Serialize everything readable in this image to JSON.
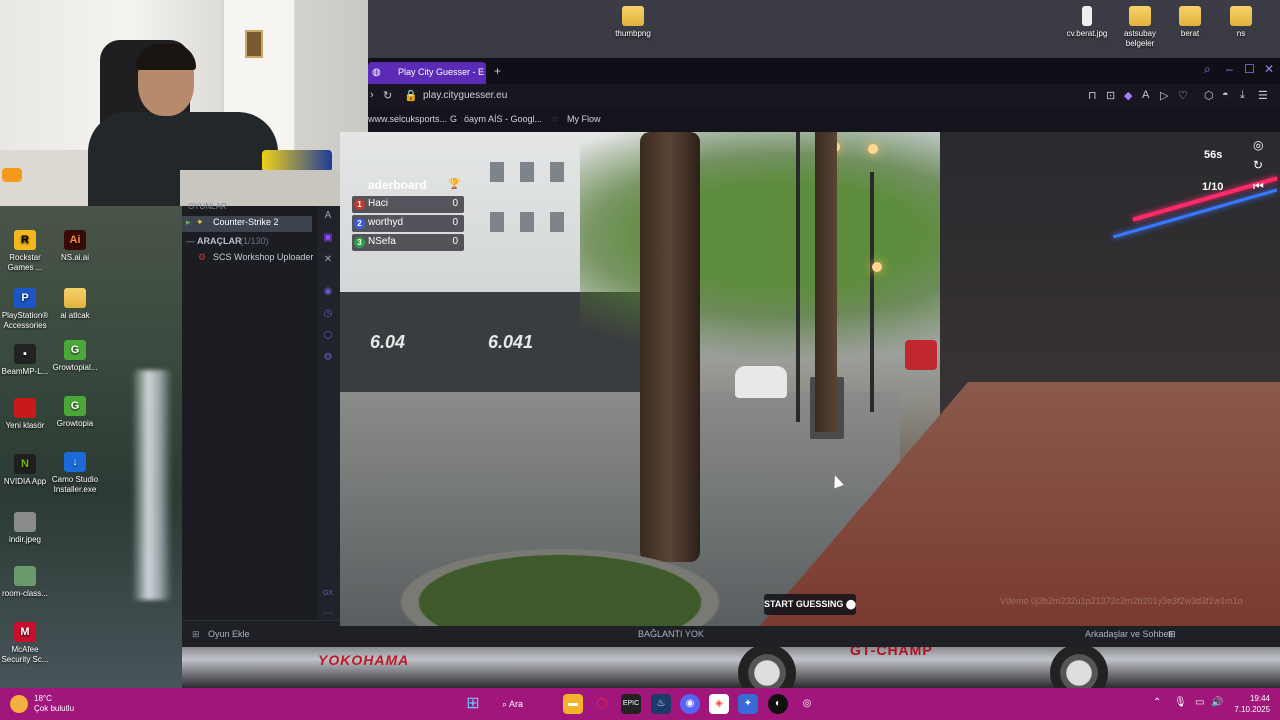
{
  "desktop": {
    "top_icons": [
      {
        "label": "thumbpng"
      },
      {
        "label": "cv.berat.jpg"
      },
      {
        "label": "astsubay belgeler"
      },
      {
        "label": "berat"
      },
      {
        "label": "ns"
      }
    ],
    "left_icons": [
      {
        "label": "Rockstar Games ..."
      },
      {
        "label": "NS.ai.ai"
      },
      {
        "label": "PlayStation® Accessories"
      },
      {
        "label": "ai atlcak"
      },
      {
        "label": "BeamMP-L..."
      },
      {
        "label": "Growtopial..."
      },
      {
        "label": "Yeni klasör"
      },
      {
        "label": "Growtopia"
      },
      {
        "label": "NVIDIA App"
      },
      {
        "label": "Camo Studio Installer.exe"
      },
      {
        "label": "indir.jpeg"
      },
      {
        "label": "room-class..."
      },
      {
        "label": "McAfee Security Sc..."
      }
    ],
    "wallpaper_brand": "YOKOHAMA",
    "wallpaper_brand2": "GT-CHAMP"
  },
  "steam": {
    "section_partial": "OYUNLAR",
    "selected_game": "Counter-Strike 2",
    "tools_label": "ARAÇLAR",
    "tools_count": "(1/130)",
    "tool_item": "SCS Workshop Uploader",
    "footer": {
      "add_game": "Oyun Ekle",
      "connection": "BAĞLANTI YOK",
      "friends": "Arkadaşlar ve Sohbet"
    },
    "side_label": "GX"
  },
  "browser": {
    "tab_title": "Play City Guesser - Ex",
    "url": "play.cityguesser.eu",
    "bookmarks": [
      "www.selcuksports...",
      "öaym AİS - Googl...",
      "My Flow"
    ]
  },
  "game": {
    "leaderboard_title": "aderboard",
    "leaderboard": [
      {
        "rank": "1",
        "name": "Haci",
        "score": "0"
      },
      {
        "rank": "2",
        "name": "worthyd",
        "score": "0"
      },
      {
        "rank": "3",
        "name": "NSefa",
        "score": "0"
      }
    ],
    "timer": "56s",
    "round": "1/10",
    "start_button": "START GUESSING",
    "store_text_1": "6.04",
    "store_text_2": "6.041",
    "watermark": "Vdemo 0j3b2m232u1p21372c2m2b201y3e3f2w3d3f1w1m1o"
  },
  "taskbar": {
    "temperature": "18°C",
    "weather": "Çok bulutlu",
    "search_label": "Ara",
    "time": "19:44",
    "date": "7.10.2025"
  },
  "colors": {
    "taskbar": "#a0167a",
    "browser_tab": "#5b2bb8",
    "browser_accent": "#9c86f0"
  }
}
